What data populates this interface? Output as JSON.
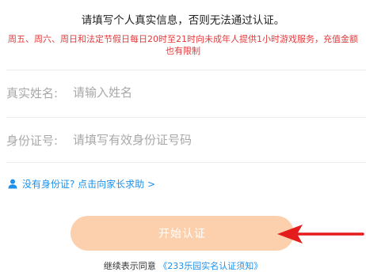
{
  "header": {
    "title": "请填写个人真实信息，否则无法通过认证。",
    "notice": "周五、周六、周日和法定节假日每日20时至21时向未成年人提供1小时游戏服务，充值金额也有限制"
  },
  "form": {
    "name_label": "真实姓名:",
    "name_placeholder": "请输入姓名",
    "name_value": "",
    "id_label": "身份证号:",
    "id_placeholder": "请填写有效身份证号码",
    "id_value": ""
  },
  "help": {
    "icon": "user-icon",
    "text": "没有身份证? 点击向家长求助 >"
  },
  "action": {
    "submit_label": "开始认证"
  },
  "agreement": {
    "prefix": "继续表示同意",
    "link": "《233乐园实名认证须知》"
  },
  "colors": {
    "notice_red": "#e5393b",
    "link_blue": "#1e90e8",
    "button_disabled": "#fdd0ad",
    "annotation_arrow": "#e41c1c"
  }
}
